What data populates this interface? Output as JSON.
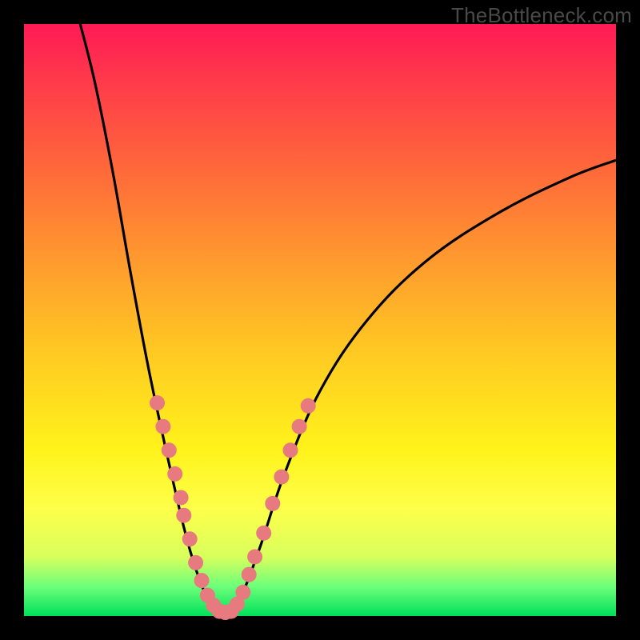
{
  "watermark": "TheBottleneck.com",
  "chart_data": {
    "type": "line",
    "title": "",
    "xlabel": "",
    "ylabel": "",
    "xlim": [
      0,
      100
    ],
    "ylim": [
      0,
      100
    ],
    "gradient_meaning": "vertical performance gradient: red (top) = high bottleneck, green (bottom) = optimal",
    "curve_points": [
      {
        "x": 9.5,
        "y": 100
      },
      {
        "x": 12,
        "y": 90
      },
      {
        "x": 15,
        "y": 75
      },
      {
        "x": 18,
        "y": 58
      },
      {
        "x": 21,
        "y": 42
      },
      {
        "x": 24,
        "y": 28
      },
      {
        "x": 27,
        "y": 15
      },
      {
        "x": 29,
        "y": 8
      },
      {
        "x": 31,
        "y": 3
      },
      {
        "x": 33,
        "y": 0.5
      },
      {
        "x": 35,
        "y": 0.5
      },
      {
        "x": 37,
        "y": 4
      },
      {
        "x": 40,
        "y": 12
      },
      {
        "x": 44,
        "y": 24
      },
      {
        "x": 50,
        "y": 38
      },
      {
        "x": 58,
        "y": 50
      },
      {
        "x": 68,
        "y": 60
      },
      {
        "x": 80,
        "y": 68
      },
      {
        "x": 92,
        "y": 74
      },
      {
        "x": 100,
        "y": 77
      }
    ],
    "marker_points": [
      {
        "x": 22.5,
        "y": 36
      },
      {
        "x": 23.5,
        "y": 32
      },
      {
        "x": 24.5,
        "y": 28
      },
      {
        "x": 25.5,
        "y": 24
      },
      {
        "x": 26.5,
        "y": 20
      },
      {
        "x": 27.0,
        "y": 17
      },
      {
        "x": 28.0,
        "y": 13
      },
      {
        "x": 29.0,
        "y": 9
      },
      {
        "x": 30.0,
        "y": 6
      },
      {
        "x": 31.0,
        "y": 3.5
      },
      {
        "x": 32.0,
        "y": 1.8
      },
      {
        "x": 33.0,
        "y": 0.8
      },
      {
        "x": 34.0,
        "y": 0.6
      },
      {
        "x": 35.0,
        "y": 0.8
      },
      {
        "x": 36.0,
        "y": 2.0
      },
      {
        "x": 37.0,
        "y": 4.0
      },
      {
        "x": 38.0,
        "y": 7.0
      },
      {
        "x": 39.0,
        "y": 10.0
      },
      {
        "x": 40.5,
        "y": 14.0
      },
      {
        "x": 42.0,
        "y": 19.0
      },
      {
        "x": 43.5,
        "y": 23.5
      },
      {
        "x": 45.0,
        "y": 28.0
      },
      {
        "x": 46.5,
        "y": 32.0
      },
      {
        "x": 48.0,
        "y": 35.5
      }
    ],
    "marker_color": "#e77a7e",
    "curve_color": "#000000"
  }
}
